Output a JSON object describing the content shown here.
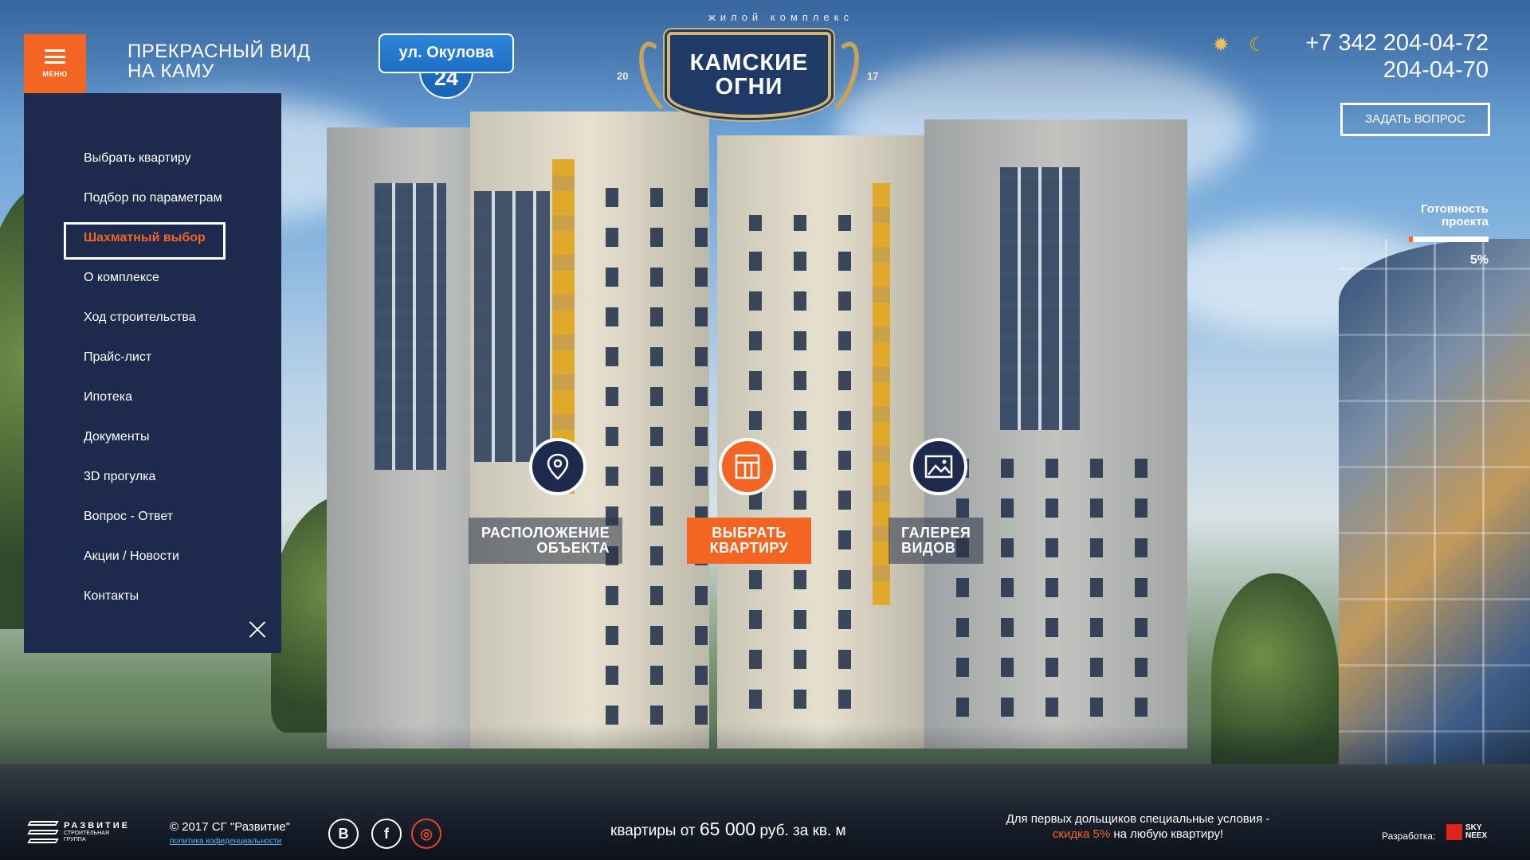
{
  "header": {
    "menu_label": "МЕНЮ",
    "tagline_line1": "ПРЕКРАСНЫЙ ВИД",
    "tagline_line2": "НА КАМУ",
    "address_street": "ул. Окулова",
    "address_number": "24",
    "logo_small": "жилой комплекс",
    "logo_line1": "КАМСКИЕ",
    "logo_line2": "ОГНИ",
    "year_left": "20",
    "year_right": "17",
    "phone1": "+7 342 204-04-72",
    "phone2": "204-04-70",
    "ask_button": "ЗАДАТЬ ВОПРОС",
    "theme_icons": [
      "sun-icon",
      "moon-icon"
    ]
  },
  "progress": {
    "title_line1": "Готовность",
    "title_line2": "проекта",
    "percent_label": "5%",
    "value": 0.05
  },
  "side_menu": {
    "items": [
      {
        "label": "Выбрать квартиру"
      },
      {
        "label": "Подбор по параметрам"
      },
      {
        "label": "Шахматный выбор",
        "active": true
      },
      {
        "label": "О комплексе"
      },
      {
        "label": "Ход строительства"
      },
      {
        "label": "Прайс-лист"
      },
      {
        "label": "Ипотека"
      },
      {
        "label": "Документы"
      },
      {
        "label": "3D прогулка"
      },
      {
        "label": "Вопрос - Ответ"
      },
      {
        "label": "Акции / Новости"
      },
      {
        "label": "Контакты"
      }
    ]
  },
  "actions": {
    "location_line1": "РАСПОЛОЖЕНИЕ",
    "location_line2": "ОБЪЕКТА",
    "choose_line1": "ВЫБРАТЬ",
    "choose_line2": "КВАРТИРУ",
    "gallery_line1": "ГАЛЕРЕЯ",
    "gallery_line2": "ВИДОВ",
    "icons": [
      "map-pin-icon",
      "floorplan-icon",
      "image-gallery-icon"
    ]
  },
  "footer": {
    "brand_name": "РАЗВИТИЕ",
    "brand_sub1": "СТРОИТЕЛЬНАЯ",
    "brand_sub2": "ГРУППА",
    "copyright": "© 2017 СГ \"Развитие\"",
    "privacy": "политика кофиденциальности",
    "social": [
      "В",
      "f",
      "◎"
    ],
    "price_prefix": "квартиры от",
    "price_value": "65 000",
    "price_suffix": "руб. за кв. м",
    "promo_line1": "Для первых дольщиков специальные условия -",
    "promo_highlight": "скидка 5%",
    "promo_rest": "на любую квартиру!",
    "dev_label": "Разработка:",
    "dev_logo_line1": "SKY",
    "dev_logo_line2": "NEEX"
  },
  "colors": {
    "accent": "#f26522",
    "navy": "#1e2a4d",
    "address_blue": "#1c6ec4",
    "gold": "#d6b66e"
  }
}
